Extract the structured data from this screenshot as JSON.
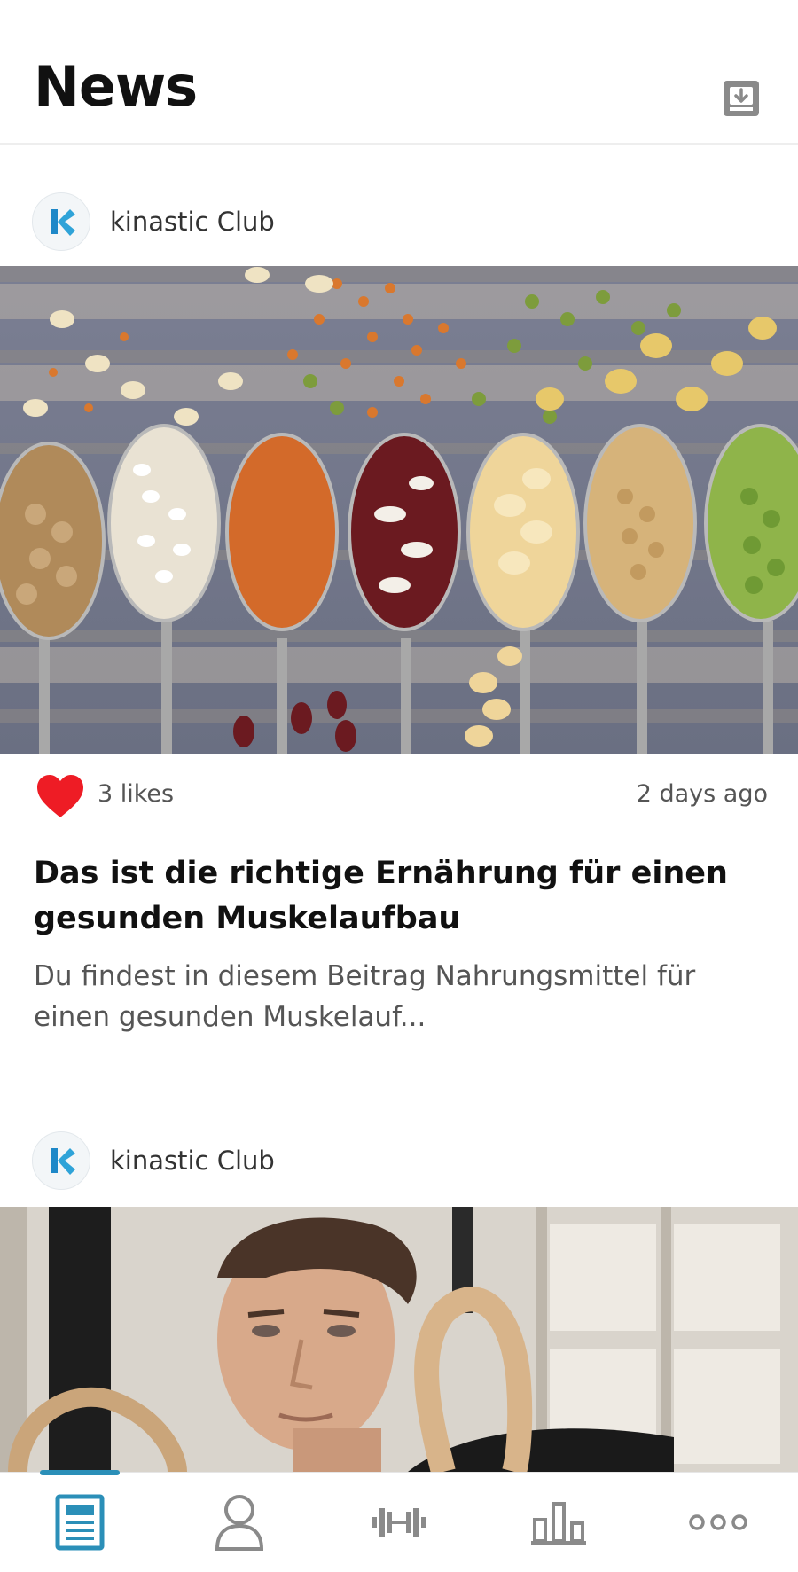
{
  "header": {
    "title": "News",
    "download_icon": "download-icon"
  },
  "colors": {
    "accent": "#2b8fb8",
    "heart": "#ee1c25",
    "muted_text": "#555555",
    "icon_gray": "#8a8a8a"
  },
  "posts": [
    {
      "author": "kinastic Club",
      "author_logo_icon": "kinastic-logo-icon",
      "image_desc": "legumes-on-spoons",
      "likes": "3 likes",
      "time": "2 days ago",
      "title": "Das ist die richtige Ernährung für einen gesunden Muskelaufbau",
      "excerpt": "Du findest in diesem Beitrag Nahrungsmittel für einen gesunden Muskelauf..."
    },
    {
      "author": "kinastic Club",
      "author_logo_icon": "kinastic-logo-icon",
      "image_desc": "man-with-gym-rings"
    }
  ],
  "bottom_nav": [
    {
      "icon": "news-icon",
      "active": true
    },
    {
      "icon": "profile-icon",
      "active": false
    },
    {
      "icon": "dumbbell-icon",
      "active": false
    },
    {
      "icon": "stats-icon",
      "active": false
    },
    {
      "icon": "more-icon",
      "active": false
    }
  ]
}
